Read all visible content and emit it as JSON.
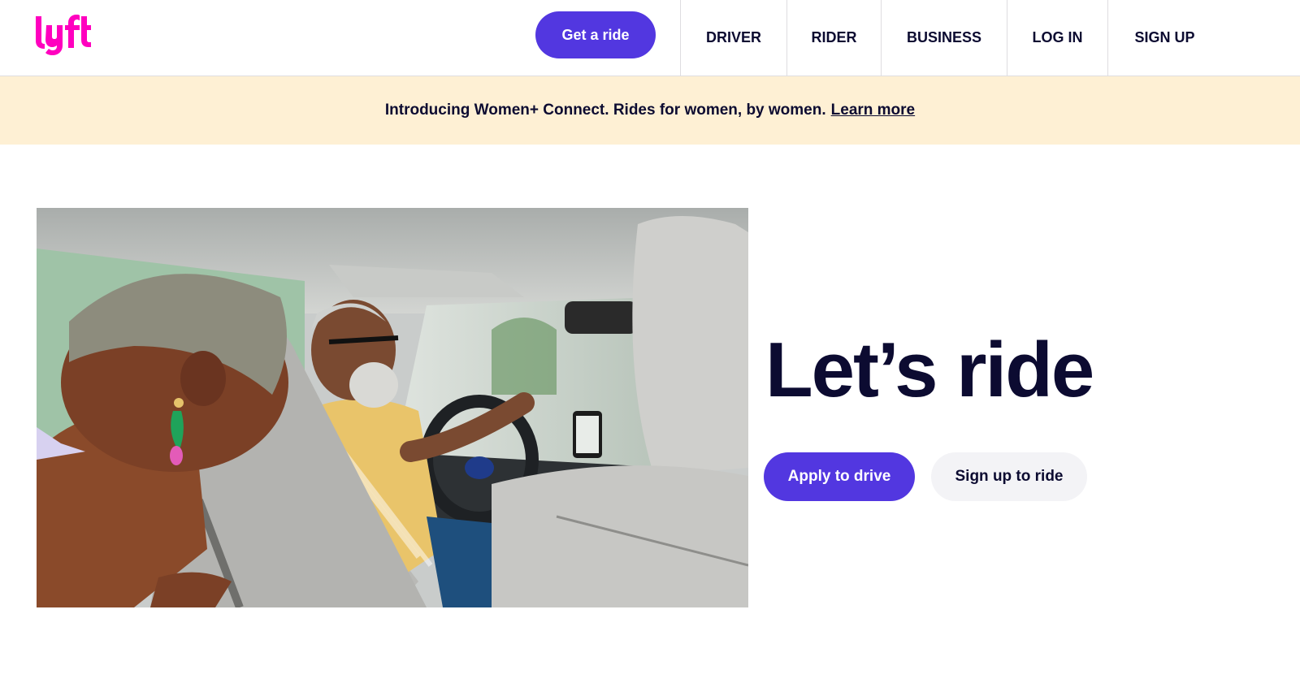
{
  "brand": {
    "name": "lyft",
    "logo_color": "#ff00bf",
    "accent_color": "#5237e0"
  },
  "header": {
    "cta_label": "Get a ride",
    "nav": [
      {
        "label": "DRIVER"
      },
      {
        "label": "RIDER"
      },
      {
        "label": "BUSINESS"
      },
      {
        "label": "LOG IN"
      },
      {
        "label": "SIGN UP"
      }
    ]
  },
  "banner": {
    "text": "Introducing Women+ Connect. Rides for women, by women.",
    "link_label": "Learn more",
    "background": "#fef0d4"
  },
  "hero": {
    "image_alt": "Smiling woman passenger in back seat and driver laughing in car",
    "title": "Let’s ride",
    "primary_button": "Apply to drive",
    "secondary_button": "Sign up to ride"
  }
}
